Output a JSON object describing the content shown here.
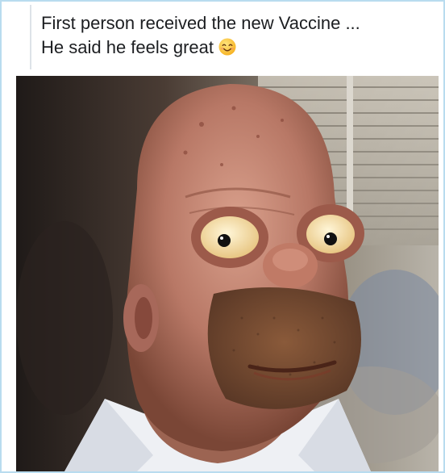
{
  "post": {
    "caption_line_1": "First person received the new Vaccine ...",
    "caption_line_2": "He said  he feels great",
    "emoji": "smiling-face-with-smiling-eyes"
  },
  "photo": {
    "description_icon": "photo"
  }
}
